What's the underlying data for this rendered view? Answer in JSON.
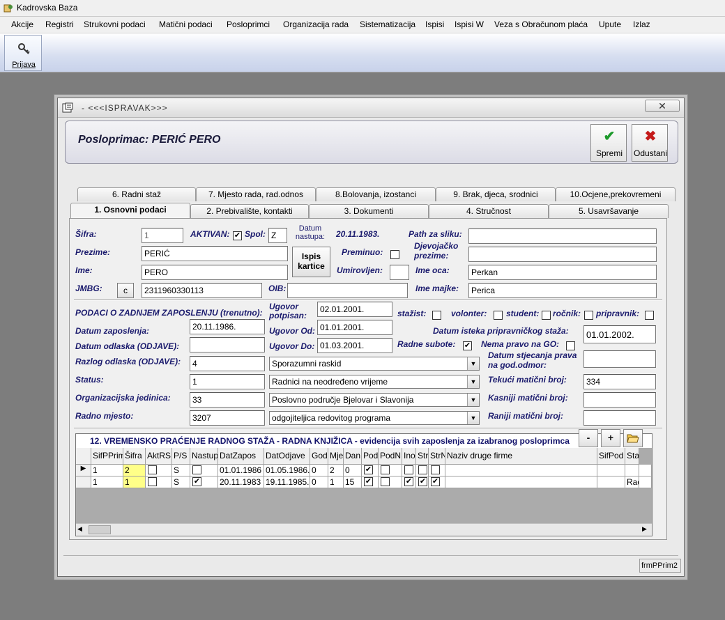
{
  "app": {
    "title": "Kadrovska Baza",
    "menu": [
      "Akcije",
      "Registri",
      "Strukovni podaci",
      "Matični podaci",
      "Posloprimci",
      "Organizacija rada",
      "Sistematizacija",
      "Ispisi",
      "Ispisi W",
      "Veza s Obračunom plaća",
      "Upute",
      "Izlaz"
    ],
    "toolbar_prijava": "Prijava"
  },
  "dialog": {
    "title": "- <<<ISPRAVAK>>>",
    "close": "✕",
    "header_label": "Posloprimac:  PERIĆ PERO",
    "save_label": "Spremi",
    "cancel_label": "Odustani",
    "tabs_row1": [
      "6. Radni staž",
      "7. Mjesto rada, rad.odnos",
      "8.Bolovanja, izostanci",
      "9. Brak, djeca, srodnici",
      "10.Ocjene,prekovremeni"
    ],
    "tabs_row2": [
      "1. Osnovni podaci",
      "2. Prebivalište, kontakti",
      "3. Dokumenti",
      "4. Stručnost",
      "5. Usavršavanje"
    ],
    "status_text": "frmPPrim2"
  },
  "form": {
    "labels": {
      "sifra": "Šifra:",
      "aktivan": "AKTIVAN:",
      "spol": "Spol:",
      "datum_nastupa": "Datum nastupa:",
      "prezime": "Prezime:",
      "ime": "Ime:",
      "jmbg": "JMBG:",
      "oib": "OIB:",
      "preminuo": "Preminuo:",
      "umirovljen": "Umirovljen:",
      "path": "Path za sliku:",
      "djevojacko": "Djevojačko prezime:",
      "ime_oca": "Ime oca:",
      "ime_majke": "Ime majke:",
      "podaci_zaposl": "PODACI O ZADNJEM ZAPOSLENJU (trenutno):",
      "ugovor_potpisan": "Ugovor potpisan:",
      "stazist": "stažist:",
      "volonter": "volonter:",
      "student": "student:",
      "rocnik": "ročnik:",
      "pripravnik": "pripravnik:",
      "datum_zap": "Datum zaposlenja:",
      "ugovor_od": "Ugovor Od:",
      "datum_pripr": "Datum isteka pripravničkog staža:",
      "datum_odl": "Datum odlaska (ODJAVE):",
      "ugovor_do": "Ugovor Do:",
      "radne_subote": "Radne subote:",
      "nema_pravo": "Nema pravo na GO:",
      "razlog_odl": "Razlog odlaska (ODJAVE):",
      "datum_stjec": "Datum stjecanja prava na god.odmor:",
      "status": "Status:",
      "tekuci_mb": "Tekući matični broj:",
      "org_jed": "Organizacijska jedinica:",
      "kasniji_mb": "Kasniji matični broj:",
      "radno_mj": "Radno mjesto:",
      "raniji_mb": "Raniji matični broj:"
    },
    "values": {
      "sifra": "1",
      "spol": "Z",
      "datum_nastupa": "20.11.1983.",
      "prezime": "PERIĆ",
      "ime": "PERO",
      "jmbg": "2311960330113",
      "oib": "",
      "ime_oca": "Perkan",
      "ime_majke": "Perica",
      "ugovor_potpisan": "02.01.2001.",
      "datum_zap": "20.11.1986.",
      "ugovor_od": "01.01.2001.",
      "datum_pripr": "01.01.2002.",
      "ugovor_do": "01.03.2001.",
      "razlog_sifra": "4",
      "razlog_naziv": "Sporazumni raskid",
      "status_sifra": "1",
      "status_naziv": "Radnici na neodređeno vrijeme",
      "tekuci_mb": "334",
      "org_sifra": "33",
      "org_naziv": "Poslovno područje Bjelovar i Slavonija",
      "rm_sifra": "3207",
      "rm_naziv": "odgojiteljica redovitog programa"
    },
    "checks": {
      "aktivan": true,
      "preminuo": false,
      "radne_subote": true,
      "nema_pravo": false,
      "stazist": false,
      "volonter": false,
      "student": false,
      "rocnik": false,
      "pripravnik": false
    },
    "ispis_btn": "Ispis kartice",
    "c_btn": "c"
  },
  "grid": {
    "caption": "12. VREMENSKO PRAĆENJE RADNOG STAŽA - RADNA KNJIŽICA - evidencija svih zaposlenja za izabranog posloprimca",
    "btn_minus": "-",
    "btn_plus": "+",
    "columns": [
      "SifPPrim",
      "Šifra",
      "AktRS",
      "P/S",
      "Nastup",
      "DatZapos",
      "DatOdjave",
      "God",
      "Mje",
      "Dan",
      "Pod",
      "PodN",
      "Ino",
      "Str",
      "StrN",
      "Naziv druge firme",
      "SifPod",
      "Sta"
    ],
    "rows": [
      {
        "sifpprim": "1",
        "sifra": "2",
        "aktrs": false,
        "ps": "S",
        "nastup": false,
        "datzapos": "01.01.1986",
        "datodjave": "01.05.1986.",
        "god": "0",
        "mje": "2",
        "dan": "0",
        "pod": true,
        "podn": false,
        "ino": false,
        "str": false,
        "strn": false,
        "naziv": "",
        "sifpod": "",
        "sta": ""
      },
      {
        "sifpprim": "1",
        "sifra": "1",
        "aktrs": false,
        "ps": "S",
        "nastup": true,
        "datzapos": "20.11.1983",
        "datodjave": "19.11.1985.",
        "god": "0",
        "mje": "1",
        "dan": "15",
        "pod": true,
        "podn": false,
        "ino": true,
        "str": true,
        "strn": true,
        "naziv": "",
        "sifpod": "",
        "sta": "Rad"
      }
    ]
  }
}
